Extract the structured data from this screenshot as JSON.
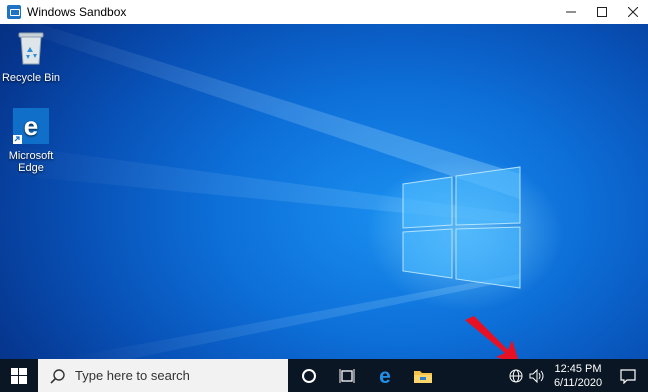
{
  "window": {
    "title": "Windows Sandbox",
    "buttons": {
      "minimize": "—",
      "maximize": "☐",
      "close": "✕"
    }
  },
  "desktop": {
    "icons": [
      {
        "label": "Recycle Bin",
        "icon": "recycle-bin-icon"
      },
      {
        "label": "Microsoft Edge",
        "icon": "edge-icon"
      }
    ]
  },
  "taskbar": {
    "search_placeholder": "Type here to search",
    "apps": [
      "cortana-icon",
      "task-view-icon",
      "edge-icon",
      "file-explorer-icon"
    ],
    "clock": {
      "time": "12:45 PM",
      "date": "6/11/2020"
    },
    "tray": [
      "network-icon",
      "volume-icon",
      "notifications-icon"
    ]
  },
  "annotation": {
    "arrow_color": "#e81123"
  }
}
